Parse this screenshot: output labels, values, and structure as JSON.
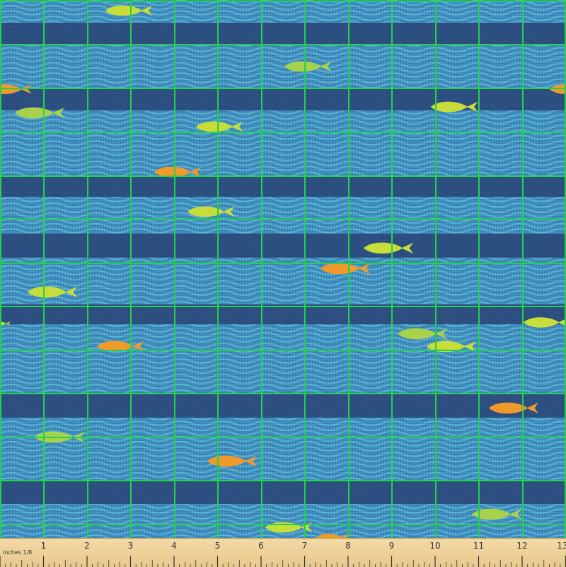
{
  "fabric": {
    "description_colors": {
      "deep_band": "#2b4a7c",
      "wave_light": "#4aa2cc",
      "wave_mid": "#3b7fb4",
      "grid_line": "#22d24a",
      "fish_yellow": "#c9dd3a",
      "fish_lime": "#a8d24c",
      "fish_orange": "#ef9a2b"
    }
  },
  "ruler": {
    "unit_label": "inches 1/8",
    "numbers": [
      "1",
      "2",
      "3",
      "4",
      "5",
      "6",
      "7",
      "8",
      "9",
      "10",
      "11",
      "12",
      "13"
    ],
    "colors": {
      "bg": "#efd49e",
      "ink": "#333333"
    }
  }
}
